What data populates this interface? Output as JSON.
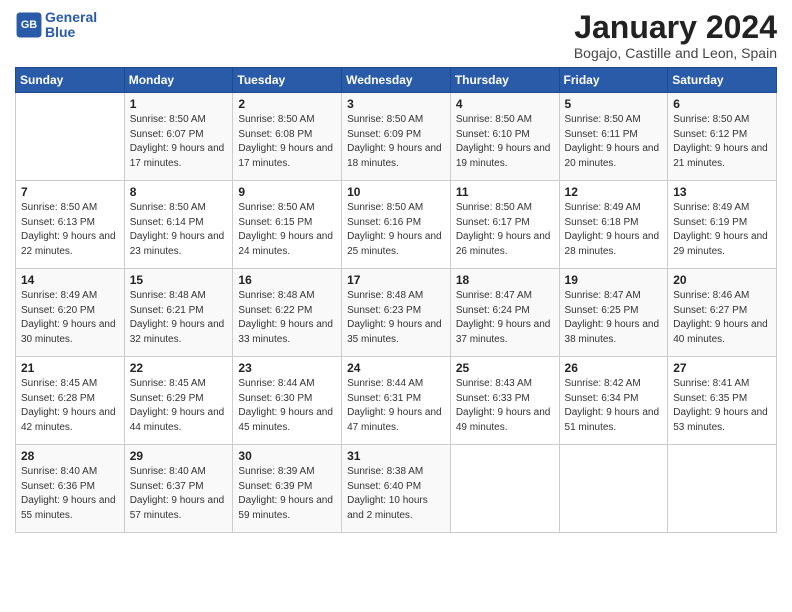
{
  "logo": {
    "line1": "General",
    "line2": "Blue"
  },
  "title": "January 2024",
  "location": "Bogajo, Castille and Leon, Spain",
  "headers": [
    "Sunday",
    "Monday",
    "Tuesday",
    "Wednesday",
    "Thursday",
    "Friday",
    "Saturday"
  ],
  "weeks": [
    [
      {
        "day": "",
        "sunrise": "",
        "sunset": "",
        "daylight": ""
      },
      {
        "day": "1",
        "sunrise": "Sunrise: 8:50 AM",
        "sunset": "Sunset: 6:07 PM",
        "daylight": "Daylight: 9 hours and 17 minutes."
      },
      {
        "day": "2",
        "sunrise": "Sunrise: 8:50 AM",
        "sunset": "Sunset: 6:08 PM",
        "daylight": "Daylight: 9 hours and 17 minutes."
      },
      {
        "day": "3",
        "sunrise": "Sunrise: 8:50 AM",
        "sunset": "Sunset: 6:09 PM",
        "daylight": "Daylight: 9 hours and 18 minutes."
      },
      {
        "day": "4",
        "sunrise": "Sunrise: 8:50 AM",
        "sunset": "Sunset: 6:10 PM",
        "daylight": "Daylight: 9 hours and 19 minutes."
      },
      {
        "day": "5",
        "sunrise": "Sunrise: 8:50 AM",
        "sunset": "Sunset: 6:11 PM",
        "daylight": "Daylight: 9 hours and 20 minutes."
      },
      {
        "day": "6",
        "sunrise": "Sunrise: 8:50 AM",
        "sunset": "Sunset: 6:12 PM",
        "daylight": "Daylight: 9 hours and 21 minutes."
      }
    ],
    [
      {
        "day": "7",
        "sunrise": "Sunrise: 8:50 AM",
        "sunset": "Sunset: 6:13 PM",
        "daylight": "Daylight: 9 hours and 22 minutes."
      },
      {
        "day": "8",
        "sunrise": "Sunrise: 8:50 AM",
        "sunset": "Sunset: 6:14 PM",
        "daylight": "Daylight: 9 hours and 23 minutes."
      },
      {
        "day": "9",
        "sunrise": "Sunrise: 8:50 AM",
        "sunset": "Sunset: 6:15 PM",
        "daylight": "Daylight: 9 hours and 24 minutes."
      },
      {
        "day": "10",
        "sunrise": "Sunrise: 8:50 AM",
        "sunset": "Sunset: 6:16 PM",
        "daylight": "Daylight: 9 hours and 25 minutes."
      },
      {
        "day": "11",
        "sunrise": "Sunrise: 8:50 AM",
        "sunset": "Sunset: 6:17 PM",
        "daylight": "Daylight: 9 hours and 26 minutes."
      },
      {
        "day": "12",
        "sunrise": "Sunrise: 8:49 AM",
        "sunset": "Sunset: 6:18 PM",
        "daylight": "Daylight: 9 hours and 28 minutes."
      },
      {
        "day": "13",
        "sunrise": "Sunrise: 8:49 AM",
        "sunset": "Sunset: 6:19 PM",
        "daylight": "Daylight: 9 hours and 29 minutes."
      }
    ],
    [
      {
        "day": "14",
        "sunrise": "Sunrise: 8:49 AM",
        "sunset": "Sunset: 6:20 PM",
        "daylight": "Daylight: 9 hours and 30 minutes."
      },
      {
        "day": "15",
        "sunrise": "Sunrise: 8:48 AM",
        "sunset": "Sunset: 6:21 PM",
        "daylight": "Daylight: 9 hours and 32 minutes."
      },
      {
        "day": "16",
        "sunrise": "Sunrise: 8:48 AM",
        "sunset": "Sunset: 6:22 PM",
        "daylight": "Daylight: 9 hours and 33 minutes."
      },
      {
        "day": "17",
        "sunrise": "Sunrise: 8:48 AM",
        "sunset": "Sunset: 6:23 PM",
        "daylight": "Daylight: 9 hours and 35 minutes."
      },
      {
        "day": "18",
        "sunrise": "Sunrise: 8:47 AM",
        "sunset": "Sunset: 6:24 PM",
        "daylight": "Daylight: 9 hours and 37 minutes."
      },
      {
        "day": "19",
        "sunrise": "Sunrise: 8:47 AM",
        "sunset": "Sunset: 6:25 PM",
        "daylight": "Daylight: 9 hours and 38 minutes."
      },
      {
        "day": "20",
        "sunrise": "Sunrise: 8:46 AM",
        "sunset": "Sunset: 6:27 PM",
        "daylight": "Daylight: 9 hours and 40 minutes."
      }
    ],
    [
      {
        "day": "21",
        "sunrise": "Sunrise: 8:45 AM",
        "sunset": "Sunset: 6:28 PM",
        "daylight": "Daylight: 9 hours and 42 minutes."
      },
      {
        "day": "22",
        "sunrise": "Sunrise: 8:45 AM",
        "sunset": "Sunset: 6:29 PM",
        "daylight": "Daylight: 9 hours and 44 minutes."
      },
      {
        "day": "23",
        "sunrise": "Sunrise: 8:44 AM",
        "sunset": "Sunset: 6:30 PM",
        "daylight": "Daylight: 9 hours and 45 minutes."
      },
      {
        "day": "24",
        "sunrise": "Sunrise: 8:44 AM",
        "sunset": "Sunset: 6:31 PM",
        "daylight": "Daylight: 9 hours and 47 minutes."
      },
      {
        "day": "25",
        "sunrise": "Sunrise: 8:43 AM",
        "sunset": "Sunset: 6:33 PM",
        "daylight": "Daylight: 9 hours and 49 minutes."
      },
      {
        "day": "26",
        "sunrise": "Sunrise: 8:42 AM",
        "sunset": "Sunset: 6:34 PM",
        "daylight": "Daylight: 9 hours and 51 minutes."
      },
      {
        "day": "27",
        "sunrise": "Sunrise: 8:41 AM",
        "sunset": "Sunset: 6:35 PM",
        "daylight": "Daylight: 9 hours and 53 minutes."
      }
    ],
    [
      {
        "day": "28",
        "sunrise": "Sunrise: 8:40 AM",
        "sunset": "Sunset: 6:36 PM",
        "daylight": "Daylight: 9 hours and 55 minutes."
      },
      {
        "day": "29",
        "sunrise": "Sunrise: 8:40 AM",
        "sunset": "Sunset: 6:37 PM",
        "daylight": "Daylight: 9 hours and 57 minutes."
      },
      {
        "day": "30",
        "sunrise": "Sunrise: 8:39 AM",
        "sunset": "Sunset: 6:39 PM",
        "daylight": "Daylight: 9 hours and 59 minutes."
      },
      {
        "day": "31",
        "sunrise": "Sunrise: 8:38 AM",
        "sunset": "Sunset: 6:40 PM",
        "daylight": "Daylight: 10 hours and 2 minutes."
      },
      {
        "day": "",
        "sunrise": "",
        "sunset": "",
        "daylight": ""
      },
      {
        "day": "",
        "sunrise": "",
        "sunset": "",
        "daylight": ""
      },
      {
        "day": "",
        "sunrise": "",
        "sunset": "",
        "daylight": ""
      }
    ]
  ]
}
